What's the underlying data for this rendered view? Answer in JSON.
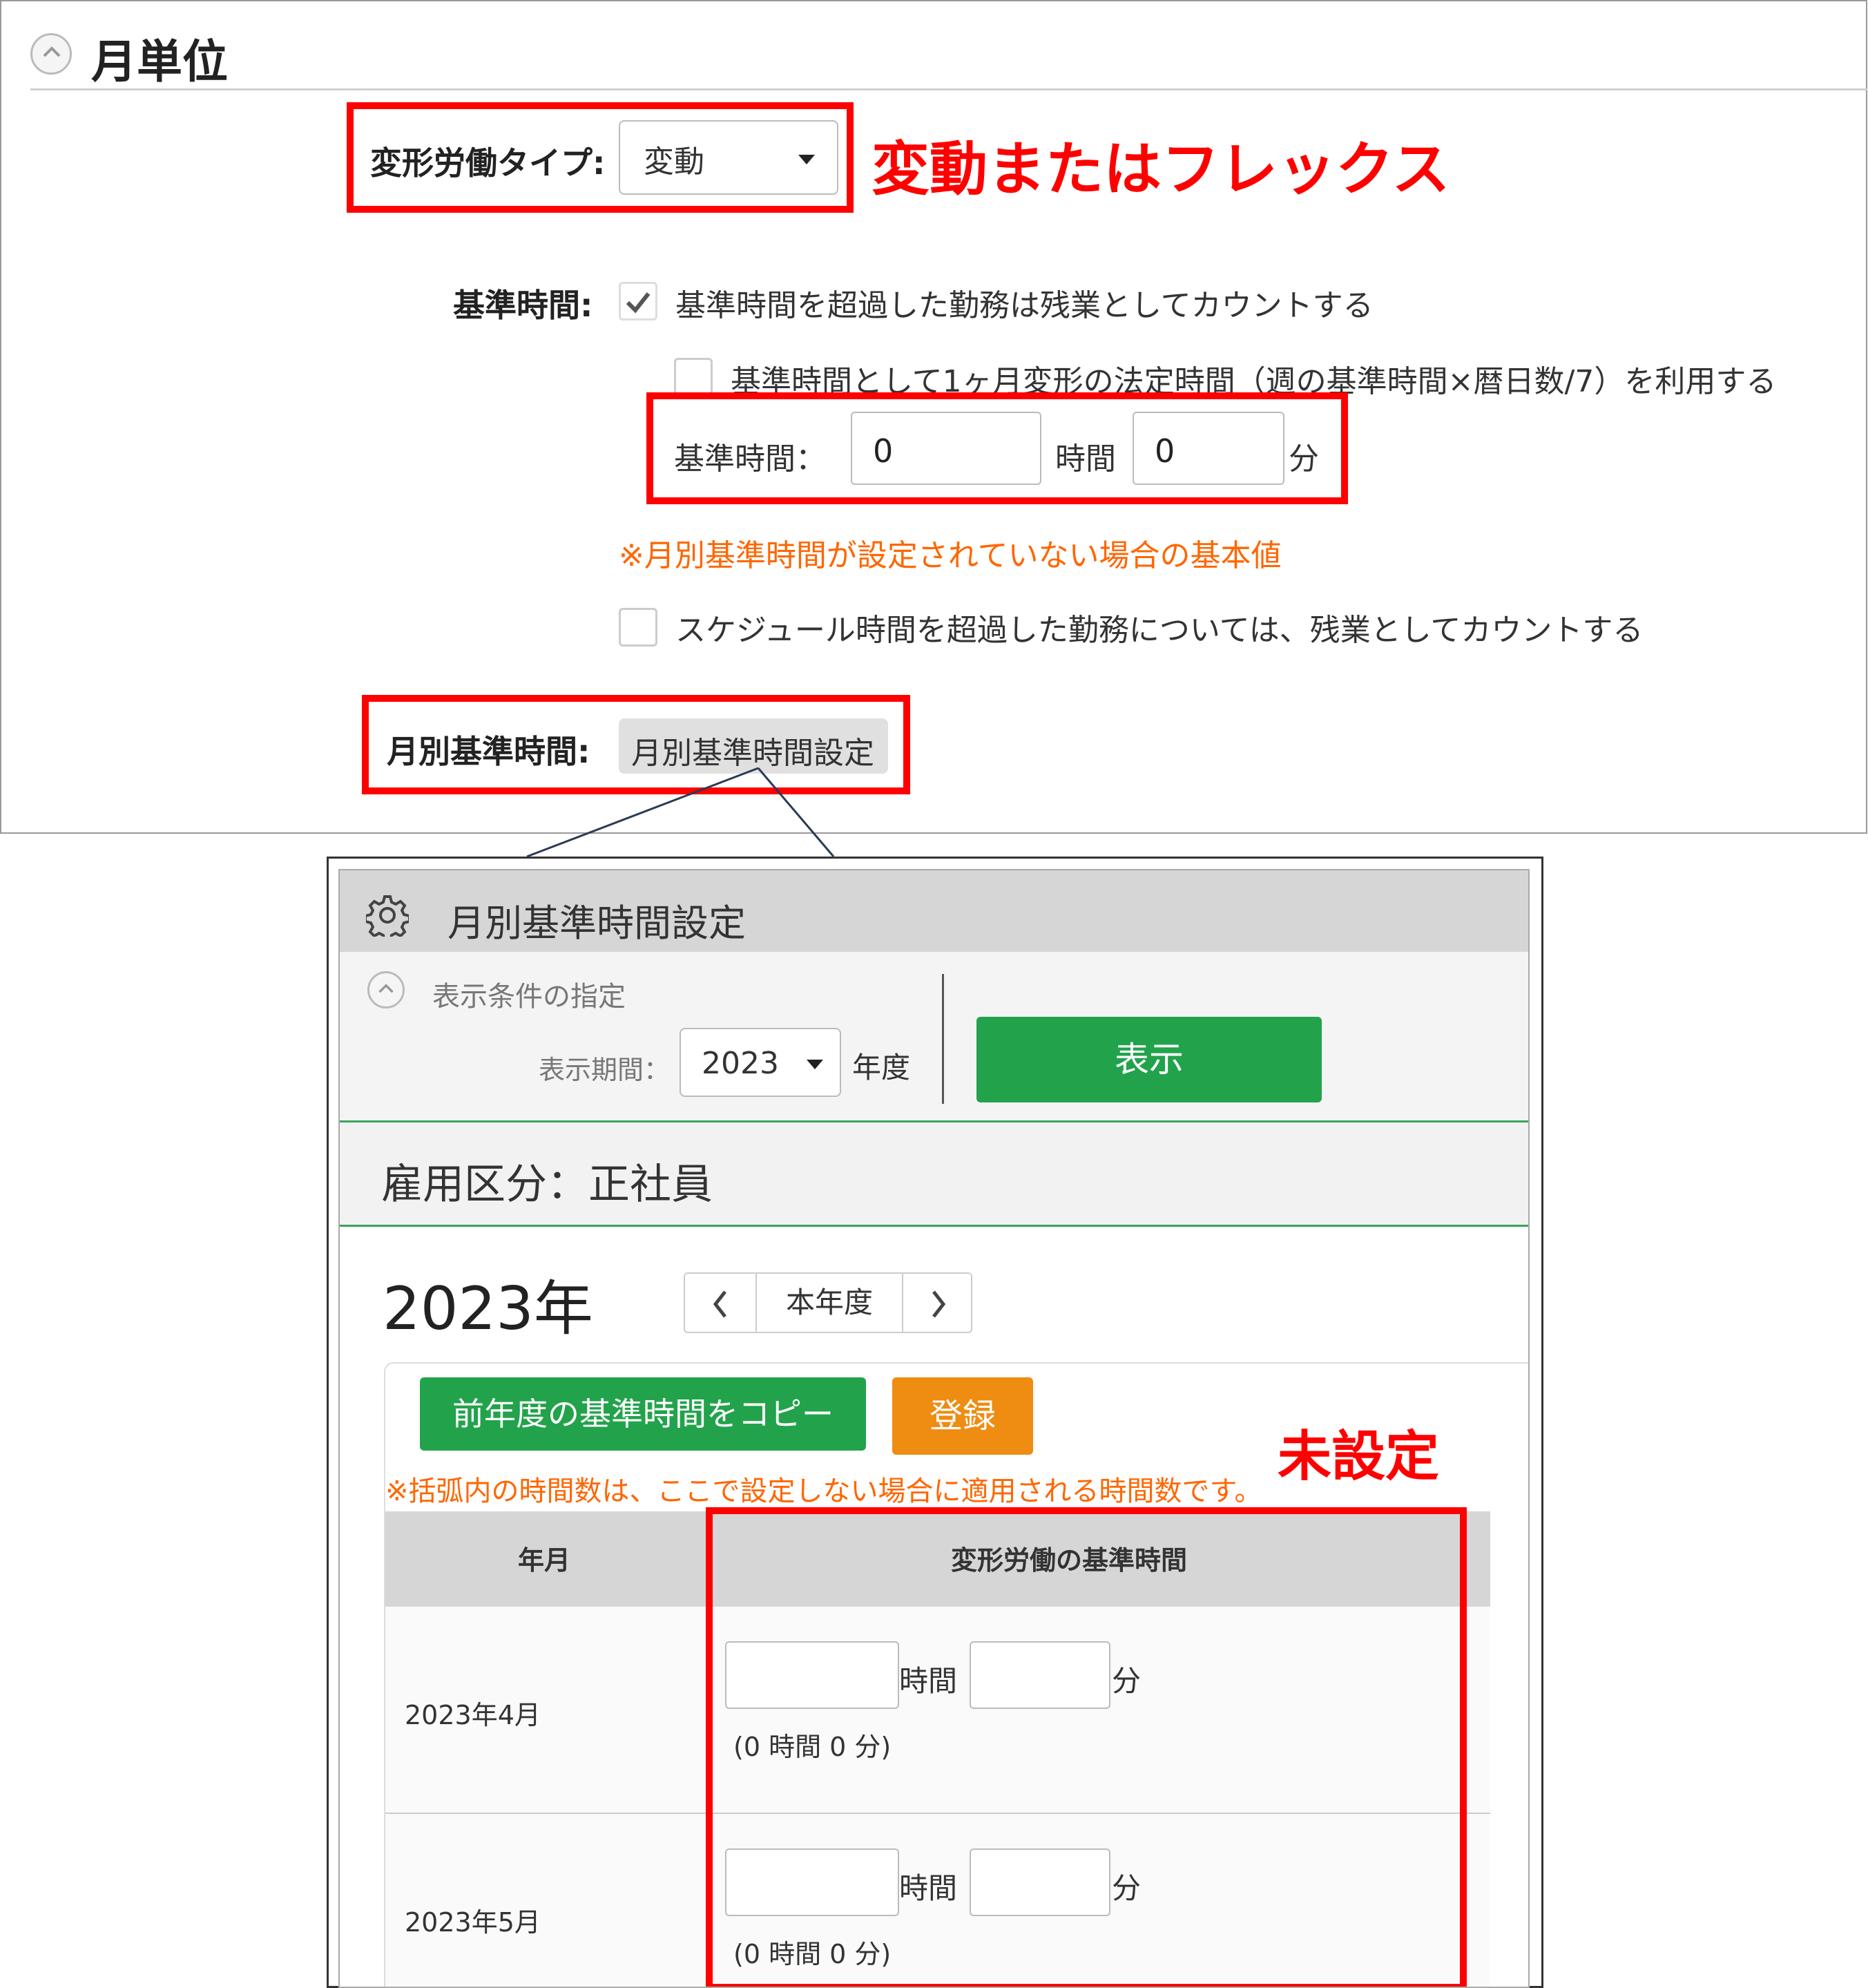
{
  "section": {
    "title": "月単位"
  },
  "henkei_type": {
    "label": "変形労働タイプ:",
    "value": "変動",
    "annotation": "変動またはフレックス"
  },
  "kijun": {
    "label": "基準時間:",
    "overtime_checkbox_label": "基準時間を超過した勤務は残業としてカウントする",
    "overtime_checked": true,
    "legal_checkbox_label": "基準時間として1ヶ月変形の法定時間（週の基準時間×暦日数/7）を利用する",
    "legal_checked": false,
    "time_label": "基準時間：",
    "hours_value": "0",
    "hours_unit": "時間",
    "minutes_value": "0",
    "minutes_unit": "分",
    "note": "※月別基準時間が設定されていない場合の基本値",
    "schedule_checkbox_label": "スケジュール時間を超過した勤務については、残業としてカウントする",
    "schedule_checked": false
  },
  "monthly": {
    "label": "月別基準時間:",
    "button_label": "月別基準時間設定"
  },
  "modal": {
    "title": "月別基準時間設定",
    "filter": {
      "title": "表示条件の指定",
      "period_label": "表示期間：",
      "year_value": "2023",
      "year_unit": "年度",
      "show_button": "表示"
    },
    "employment": "雇用区分：正社員",
    "year_heading": "2023年",
    "pager": {
      "prev": "<",
      "current": "本年度",
      "next": ">"
    },
    "copy_button": "前年度の基準時間をコピー",
    "register_button": "登録",
    "unset_annotation": "未設定",
    "note": "※括弧内の時間数は、ここで設定しない場合に適用される時間数です。",
    "table": {
      "headers": [
        "年月",
        "変形労働の基準時間"
      ],
      "hours_unit": "時間",
      "minutes_unit": "分",
      "rows": [
        {
          "month": "2023年4月",
          "hours": "",
          "minutes": "",
          "default": "(0 時間 0 分)"
        },
        {
          "month": "2023年5月",
          "hours": "",
          "minutes": "",
          "default": "(0 時間 0 分)"
        }
      ]
    }
  },
  "colors": {
    "annotation_red": "#ff0000",
    "note_orange": "#ff6600",
    "green_button": "#22a34b",
    "orange_button": "#ef8c12",
    "header_gray": "#d6d6d6"
  }
}
